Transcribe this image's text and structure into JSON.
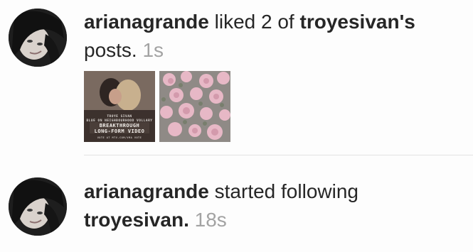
{
  "notifications": [
    {
      "user": "arianagrande",
      "action": "liked 2 of",
      "target": "troyesivan's",
      "suffix": "posts.",
      "time": "1s",
      "poster": {
        "small_line1": "TROYE SIVAN",
        "small_line2": "BLUE ON NEIGHBOURHOOD VOLLARY",
        "big_line1": "BREAKTHROUGH",
        "big_line2": "LONG-FORM VIDEO",
        "footer": "VOTE AT MTV.COM/VMA VOTE"
      }
    },
    {
      "user": "arianagrande",
      "action": "started following",
      "target": "troyesivan.",
      "time": "18s"
    }
  ],
  "colors": {
    "text": "#262626",
    "timestamp": "#a3a3a3",
    "divider": "#e3e3e3",
    "background": "#fdfdfd"
  }
}
